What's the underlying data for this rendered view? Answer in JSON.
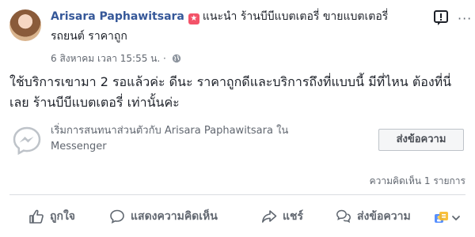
{
  "post": {
    "author": "Arisara Paphawitsara",
    "action_text": "แนะนำ ร้านบีบีแบตเตอรี่ ขายแบตเตอรี่",
    "page_name_line2": "รถยนต์ ราคาถูก",
    "timestamp": "6 สิงหาคม เวลา 15:55 น.",
    "separator": "·",
    "privacy_icon": "globe-icon",
    "body_line1": "ใช้บริการเขามา 2 รอแล้วค่ะ ดีนะ ราคาถูกดีและบริการถึงที่แบบนี้ มีที่ไหน ต้องที่นี่",
    "body_line2": "เลย ร้านบีบีแบตเตอรี่ เท่านั้นค่ะ"
  },
  "messenger_card": {
    "line1": "เริ่มการสนทนาส่วนตัวกับ Arisara Paphawitsara ใน",
    "line2": "Messenger",
    "button_label": "ส่งข้อความ"
  },
  "comments": {
    "count_label": "ความคิดเห็น 1 รายการ"
  },
  "actions": {
    "like": "ถูกใจ",
    "comment": "แสดงความคิดเห็น",
    "share": "แชร์",
    "message": "ส่งข้อความ"
  },
  "colors": {
    "author_link": "#365899",
    "recommend_badge": "#f35369",
    "messenger_blue": "#0084ff",
    "muted_text": "#616770"
  }
}
